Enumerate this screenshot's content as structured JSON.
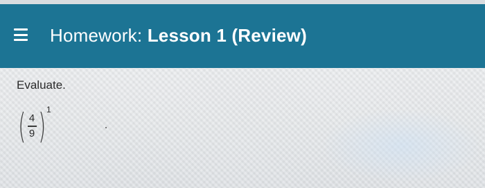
{
  "header": {
    "title_prefix": "Homework:",
    "title_name": "Lesson 1 (Review)",
    "menu_icon": "hamburger-menu-icon",
    "background_color": "#1c7494"
  },
  "question": {
    "prompt": "Evaluate.",
    "numerator": "4",
    "denominator": "9",
    "exponent": "1"
  }
}
